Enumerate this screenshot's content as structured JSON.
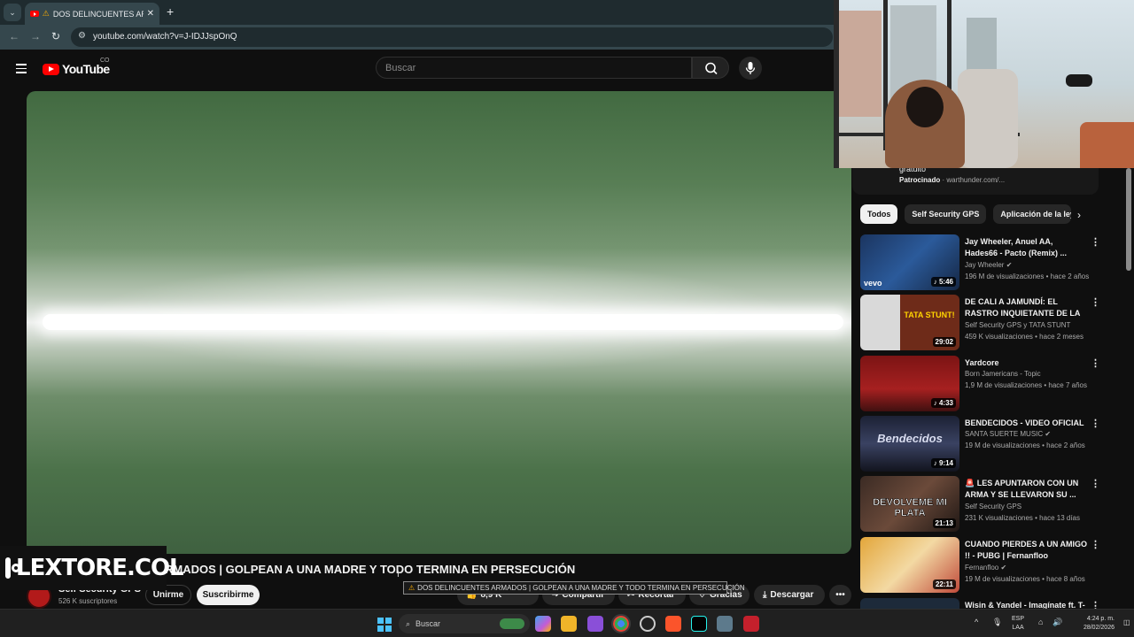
{
  "browser": {
    "tab_title": "DOS DELINCUENTES ARMA",
    "tab_close": "✕",
    "new_tab": "+",
    "url": "youtube.com/watch?v=J-IDJJspOnQ"
  },
  "youtube": {
    "logo_text": "YouTube",
    "country_code": "CO",
    "search_placeholder": "Buscar"
  },
  "video": {
    "title_visible": "RMADOS | GOLPEAN A UNA MADRE Y TODO TERMINA EN PERSECUCIÓN",
    "tooltip": "DOS DELINCUENTES ARMADOS | GOLPEAN A UNA MADRE Y TODO TERMINA EN PERSECUCIÓN"
  },
  "channel": {
    "name": "Self Security GPS",
    "subscribers": "526 K suscriptores",
    "join_label": "Unirme",
    "subscribe_label": "Suscribirme"
  },
  "actions": {
    "likes": "8,9 K",
    "share": "Compartir",
    "clip": "Recortar",
    "thanks": "Gracias",
    "download": "Descargar"
  },
  "watermark": {
    "text": "LEXTORE.COL"
  },
  "sponsor": {
    "gratuito": "gratuito",
    "label": "Patrocinado",
    "domain": "warthunder.com/..."
  },
  "chips": [
    "Todos",
    "Self Security GPS",
    "Aplicación de la ley"
  ],
  "recommendations": [
    {
      "title": "Jay Wheeler, Anuel AA, Hades66 - Pacto (Remix) ...",
      "channel": "Jay Wheeler",
      "meta": "196 M de visualizaciones • hace 2 años",
      "duration": "5:46",
      "thumb_text": "vevo"
    },
    {
      "title": "DE CALI A JAMUNDÍ: EL RASTRO INQUIETANTE DE LA ...",
      "channel": "Self Security GPS y TATA STUNT",
      "meta": "459 K visualizaciones • hace 2 meses",
      "duration": "29:02",
      "thumb_text": "TATA STUNT!"
    },
    {
      "title": "Yardcore",
      "channel": "Born Jamericans - Topic",
      "meta": "1,9 M de visualizaciones • hace 7 años",
      "duration": "4:33",
      "thumb_text": ""
    },
    {
      "title": "BENDECIDOS - VIDEO OFICIAL",
      "channel": "SANTA SUERTE MUSIC",
      "meta": "19 M de visualizaciones • hace 2 años",
      "duration": "9:14",
      "thumb_text": "Bendecidos"
    },
    {
      "title": "🚨 LES APUNTARON CON UN ARMA Y SE LLEVARON SU ...",
      "channel": "Self Security GPS",
      "meta": "231 K visualizaciones • hace 13 días",
      "duration": "21:13",
      "thumb_text": "DEVOLVEME MI PLATA"
    },
    {
      "title": "CUANDO PIERDES A UN AMIGO !! - PUBG | Fernanfloo",
      "channel": "Fernanfloo",
      "meta": "19 M de visualizaciones • hace 8 años",
      "duration": "22:11",
      "thumb_text": ""
    },
    {
      "title": "Wisin & Yandel - Imagínate ft. T-",
      "channel": "",
      "meta": "",
      "duration": "",
      "thumb_text": ""
    }
  ],
  "taskbar": {
    "search_placeholder": "Buscar",
    "lang_line1": "ESP",
    "lang_line2": "LAA",
    "time": "4:24 p. m.",
    "date": "28/02/2026"
  },
  "colors": {
    "yt_red": "#ff0000",
    "bg": "#0f0f0f",
    "chip_active": "#f1f1f1",
    "windows_blue": "#4cc2ff"
  }
}
